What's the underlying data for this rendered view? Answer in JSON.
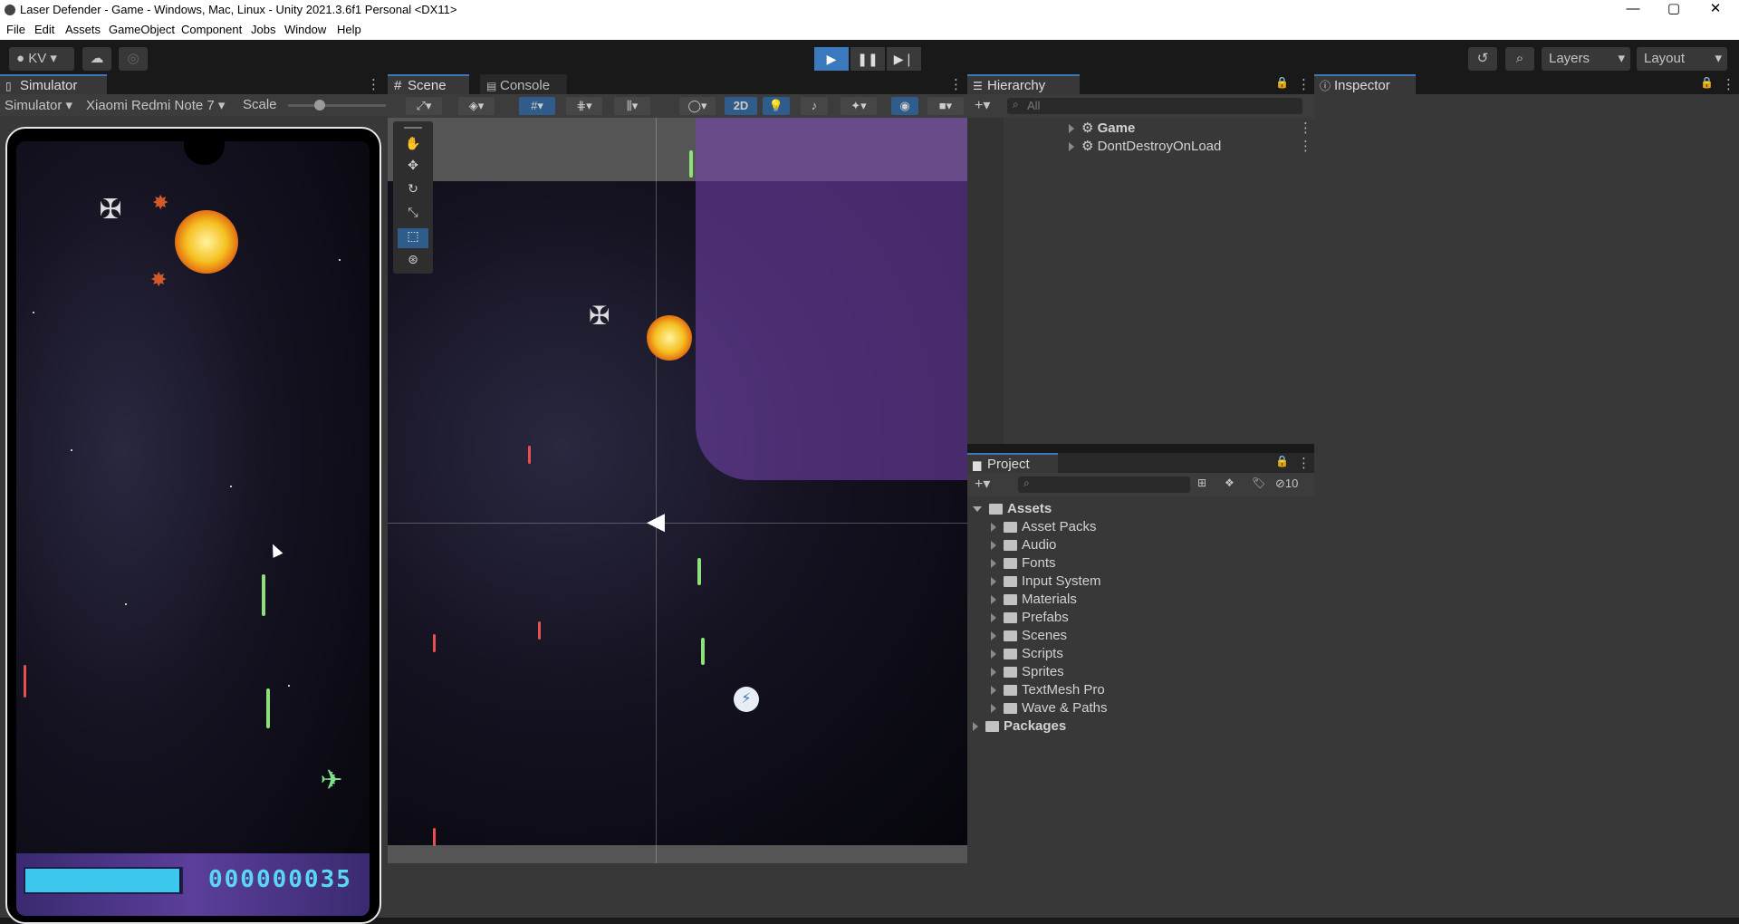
{
  "window": {
    "title": "Laser Defender - Game - Windows, Mac, Linux - Unity 2021.3.6f1 Personal <DX11>",
    "minimize": "—",
    "maximize": "▢",
    "close": "✕"
  },
  "menu": [
    "File",
    "Edit",
    "Assets",
    "GameObject",
    "Component",
    "Jobs",
    "Window",
    "Help"
  ],
  "toolbar": {
    "account": "KV",
    "play_icon": "▶",
    "pause_icon": "❚❚",
    "step_icon": "▶❘",
    "history_icon": "history-icon",
    "search_icon": "search-icon",
    "layers": "Layers",
    "layout": "Layout",
    "accent": "#3a79bb"
  },
  "simulator": {
    "tab": "Simulator",
    "mode": "Simulator",
    "device": "Xiaomi Redmi Note 7",
    "scale_label": "Scale",
    "scale_value": 0.35,
    "score": "000000035",
    "health_fraction": 0.99
  },
  "scene": {
    "tabs": [
      "Scene",
      "Console"
    ],
    "mode_2d": "2D",
    "tools": [
      "hand-tool-icon",
      "move-tool-icon",
      "rotate-tool-icon",
      "scale-tool-icon",
      "rect-tool-icon",
      "transform-tool-icon"
    ]
  },
  "hierarchy": {
    "tab": "Hierarchy",
    "search_placeholder": "All",
    "items": [
      "Game",
      "DontDestroyOnLoad"
    ]
  },
  "inspector": {
    "tab": "Inspector"
  },
  "project": {
    "tab": "Project",
    "hidden_count": "10",
    "root": "Assets",
    "folders": [
      "Asset Packs",
      "Audio",
      "Fonts",
      "Input System",
      "Materials",
      "Prefabs",
      "Scenes",
      "Scripts",
      "Sprites",
      "TextMesh Pro",
      "Wave & Paths"
    ],
    "packages": "Packages"
  }
}
